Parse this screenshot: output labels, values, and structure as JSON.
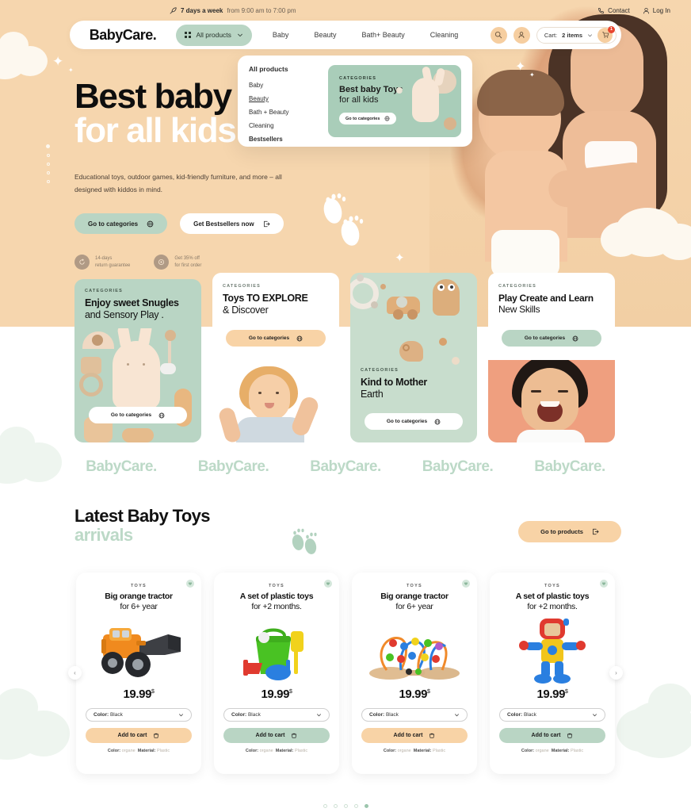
{
  "topbar": {
    "schedule_icon": "rocket-icon",
    "schedule_bold": "7 days a week",
    "schedule_rest": "from 9:00 am to 7:00 pm",
    "contact_label": "Contact",
    "contact_icon": "phone-icon",
    "login_label": "Log In",
    "login_icon": "user-icon"
  },
  "nav": {
    "brand": "BabyCare.",
    "all_products_label": "All products",
    "all_products_icon": "grid-icon",
    "chevron_icon": "chevron-down-icon",
    "links": [
      "Baby",
      "Beauty",
      "Bath+ Beauty",
      "Cleaning"
    ],
    "search_icon": "search-icon",
    "account_icon": "user-icon",
    "cart_label": "Cart:",
    "cart_count_text": "2 items",
    "cart_icon": "cart-icon",
    "cart_badge": "1"
  },
  "mega_menu": {
    "header": "All products",
    "items": [
      "Baby",
      "Beauty",
      "Bath + Beauty",
      "Cleaning",
      "Bestsellers"
    ],
    "promo": {
      "label": "CATEGORIES",
      "title_bold": "Best baby Toys",
      "title_light": "for all kids",
      "cta": "Go to categories",
      "cta_icon": "globe-icon"
    }
  },
  "hero": {
    "title_line1": "Best baby",
    "title_line2": "for all kids",
    "subtitle": "Educational toys, outdoor games, kid-friendly furniture, and more – all designed with kiddos in mind.",
    "primary_cta": "Go to categories",
    "primary_cta_icon": "globe-icon",
    "secondary_cta": "Get Bestsellers now",
    "secondary_cta_icon": "external-link-icon",
    "perks": [
      {
        "icon": "return-icon",
        "line1": "14-days",
        "line2": "return guarantee"
      },
      {
        "icon": "discount-icon",
        "line1": "Get 35% off",
        "line2": "for first order"
      }
    ]
  },
  "categories": {
    "label": "CATEGORIES",
    "cta": "Go to categories",
    "cta_icon": "globe-icon",
    "cards": [
      {
        "title_bold": "Enjoy sweet Snugles",
        "title_light": "and Sensory Play .",
        "theme": "#b9d5c4"
      },
      {
        "title_bold": "Toys TO EXPLORE",
        "title_light": "& Discover",
        "theme": "#ffffff"
      },
      {
        "title_bold": "Kind to Mother",
        "title_light": "Earth",
        "theme": "#c8ddcd"
      },
      {
        "title_bold": "Play Create and Learn",
        "title_light": "New Skills",
        "theme": "#ffffff"
      }
    ]
  },
  "marquee": {
    "items": [
      "BabyCare.",
      "BabyCare.",
      "BabyCare.",
      "BabyCare.",
      "BabyCare."
    ]
  },
  "latest": {
    "heading": "Latest Baby Toys",
    "subheading": "arrivals",
    "footprints_icon": "footprints-icon",
    "cta": "Go to products",
    "cta_icon": "external-link-icon"
  },
  "products": {
    "select_prefix": "Color:",
    "select_value": "Black",
    "select_chevron_icon": "chevron-down-icon",
    "add_to_cart": "Add to cart",
    "add_to_cart_icon": "cart-icon",
    "favorite_icon": "heart-icon",
    "meta_color_label": "Color:",
    "meta_color_value": "organe",
    "meta_material_label": "Material:",
    "meta_material_value": "Plastic",
    "currency": "$",
    "items": [
      {
        "tag": "TOYS",
        "name_bold": "Big orange tractor",
        "name_light": "for 6+ year",
        "price": "19.99",
        "btn_color": "#f8d3a6",
        "image": "orange-tractor"
      },
      {
        "tag": "TOYS",
        "name_bold": "A set of plastic toys",
        "name_light": "for +2 months.",
        "price": "19.99",
        "btn_color": "#b9d5c4",
        "image": "plastic-bucket-set"
      },
      {
        "tag": "TOYS",
        "name_bold": "Big orange tractor",
        "name_light": "for 6+ year",
        "price": "19.99",
        "btn_color": "#f8d3a6",
        "image": "bead-maze"
      },
      {
        "tag": "TOYS",
        "name_bold": "A set of plastic toys",
        "name_light": "for +2 months.",
        "price": "19.99",
        "btn_color": "#b9d5c4",
        "image": "block-robot"
      }
    ],
    "prev_icon": "chevron-left-icon",
    "next_icon": "chevron-right-icon",
    "dots": 5,
    "active_dot": 5
  },
  "colors": {
    "hero_bg": "#f6d6ae",
    "mint": "#b9d5c4",
    "peach": "#f8d3a6",
    "brand_mint": "#bcd9c7",
    "badge_red": "#e8452f"
  }
}
